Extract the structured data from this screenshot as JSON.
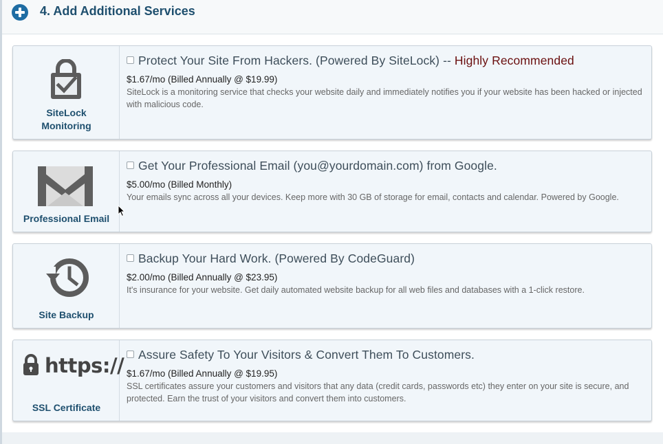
{
  "header": {
    "title": "4. Add Additional Services"
  },
  "services": [
    {
      "side_label_1": "SiteLock",
      "side_label_2": "Monitoring",
      "headline": "Protect Your Site From Hackers. (Powered By SiteLock) -- ",
      "recommended": "Highly Recommended",
      "price": "$1.67/mo (Billed Annually @ $19.99)",
      "description": "SiteLock is a monitoring service that checks your website daily and immediately notifies you if your website has been hacked or injected with malicious code.",
      "icon": "shield-lock-check-icon"
    },
    {
      "side_label_1": "Professional Email",
      "headline": "Get Your Professional Email (you@yourdomain.com) from Google.",
      "price": "$5.00/mo (Billed Monthly)",
      "description": "Your emails sync across all your devices. Keep more with 30 GB of storage for email, contacts and calendar. Powered by Google.",
      "icon": "gmail-envelope-icon"
    },
    {
      "side_label_1": "Site Backup",
      "headline": "Backup Your Hard Work. (Powered By CodeGuard)",
      "price": "$2.00/mo (Billed Annually @ $23.95)",
      "description": "It's insurance for your website. Get daily automated website backup for all web files and databases with a 1-click restore.",
      "icon": "history-clock-icon"
    },
    {
      "side_label_1": "SSL Certificate",
      "https_text": "https://",
      "headline": "Assure Safety To Your Visitors & Convert Them To Customers.",
      "price": "$1.67/mo (Billed Annually @ $19.95)",
      "description": "SSL certificates assure your customers and visitors that any data (credit cards, passwords etc) they enter on your site is secure, and protected. Earn the trust of your visitors and convert them into customers.",
      "icon": "padlock-icon"
    }
  ],
  "colors": {
    "accent": "#1f6da3",
    "title": "#1e4f6e",
    "recommended": "#6a0f0f",
    "card_bg": "#f1f6fa"
  }
}
